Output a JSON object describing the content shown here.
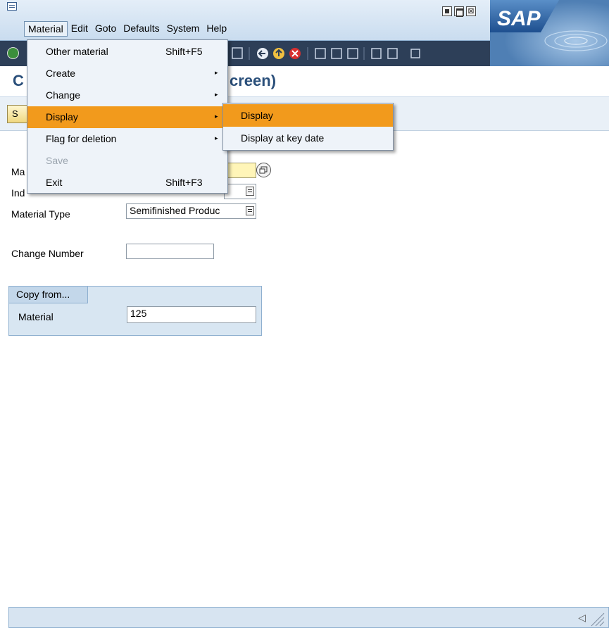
{
  "menubar": {
    "items": [
      "Material",
      "Edit",
      "Goto",
      "Defaults",
      "System",
      "Help"
    ]
  },
  "window_controls": {
    "minimize_icon": "minimize-icon",
    "maximize_icon": "maximize-icon",
    "close_icon": "close-icon",
    "close_glyph": "⊠"
  },
  "logo": {
    "text": "SAP"
  },
  "toolbar": {
    "icons": [
      "ok-icon",
      "save-icon",
      "back-icon",
      "exit-icon",
      "cancel-icon",
      "print-icon",
      "find-icon",
      "find-next-icon",
      "first-page-icon",
      "last-page-icon",
      "layout-menu-icon"
    ]
  },
  "page": {
    "title_visible_left": "C",
    "title_visible_right": "creen)"
  },
  "app_toolbar": {
    "button_label": "S"
  },
  "form": {
    "material_label": "Ma",
    "industry_label": "Ind",
    "material_type_label": "Material Type",
    "material_type_value": "Semifinished Produc",
    "change_number_label": "Change Number",
    "change_number_value": ""
  },
  "copy_from": {
    "tab_label": "Copy from...",
    "material_label": "Material",
    "material_value": "125"
  },
  "material_menu": {
    "items": [
      {
        "label": "Other material",
        "shortcut": "Shift+F5",
        "submenu": false,
        "enabled": true
      },
      {
        "label": "Create",
        "shortcut": "",
        "submenu": true,
        "enabled": true
      },
      {
        "label": "Change",
        "shortcut": "",
        "submenu": true,
        "enabled": true
      },
      {
        "label": "Display",
        "shortcut": "",
        "submenu": true,
        "enabled": true,
        "highlighted": true
      },
      {
        "label": "Flag for deletion",
        "shortcut": "",
        "submenu": true,
        "enabled": true
      },
      {
        "label": "Save",
        "shortcut": "",
        "submenu": false,
        "enabled": false
      },
      {
        "label": "Exit",
        "shortcut": "Shift+F3",
        "submenu": false,
        "enabled": true
      }
    ],
    "arrow": "▸"
  },
  "display_submenu": {
    "items": [
      {
        "label": "Display",
        "highlighted": true
      },
      {
        "label": "Display at key date",
        "highlighted": false
      }
    ]
  },
  "colors": {
    "highlight": "#f29a1c",
    "toolbar_bg": "#2d3f58",
    "title_blue": "#2a4f7a"
  }
}
